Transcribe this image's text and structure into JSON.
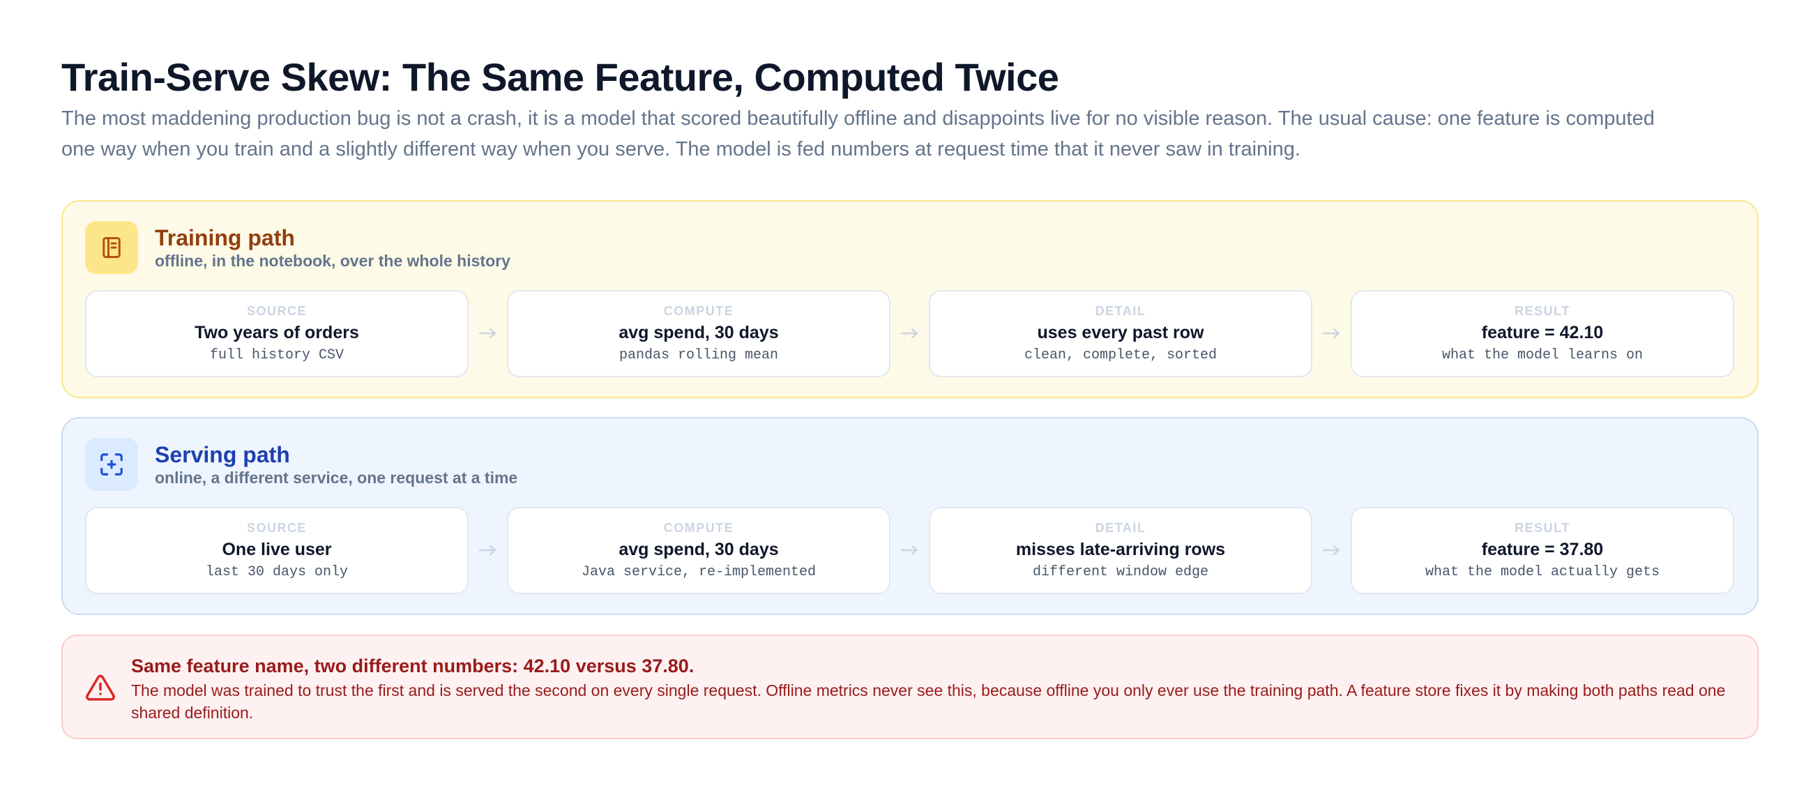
{
  "header": {
    "title": "Train-Serve Skew: The Same Feature, Computed Twice",
    "subtitle": "The most maddening production bug is not a crash, it is a model that scored beautifully offline and disappoints live for no visible reason. The usual cause: one feature is computed one way when you train and a slightly different way when you serve. The model is fed numbers at request time that it never saw in training."
  },
  "training": {
    "icon": "notebook-icon",
    "title": "Training path",
    "subtitle": "offline, in the notebook, over the whole history",
    "steps": [
      {
        "label": "SOURCE",
        "main": "Two years of orders",
        "note": "full history CSV"
      },
      {
        "label": "COMPUTE",
        "main": "avg spend, 30 days",
        "note": "pandas rolling mean"
      },
      {
        "label": "DETAIL",
        "main": "uses every past row",
        "note": "clean, complete, sorted"
      },
      {
        "label": "RESULT",
        "main": "feature = 42.10",
        "note": "what the model learns on"
      }
    ]
  },
  "serving": {
    "icon": "focus-plus-icon",
    "title": "Serving path",
    "subtitle": "online, a different service, one request at a time",
    "steps": [
      {
        "label": "SOURCE",
        "main": "One live user",
        "note": "last 30 days only"
      },
      {
        "label": "COMPUTE",
        "main": "avg spend, 30 days",
        "note": "Java service, re-implemented"
      },
      {
        "label": "DETAIL",
        "main": "misses late-arriving rows",
        "note": "different window edge"
      },
      {
        "label": "RESULT",
        "main": "feature = 37.80",
        "note": "what the model actually gets"
      }
    ]
  },
  "alert": {
    "icon": "warning-triangle-icon",
    "title": "Same feature name, two different numbers: 42.10 versus 37.80.",
    "body": "The model was trained to trust the first and is served the second on every single request. Offline metrics never see this, because offline you only ever use the training path. A feature store fixes it by making both paths read one shared definition."
  },
  "colors": {
    "training_bg": "#fefae8",
    "training_border": "#fce68a",
    "training_accent": "#92400e",
    "serving_bg": "#eef5fe",
    "serving_border": "#c8ddf5",
    "serving_accent": "#1e40af",
    "alert_bg": "#fef1f1",
    "alert_text": "#991b1b"
  }
}
